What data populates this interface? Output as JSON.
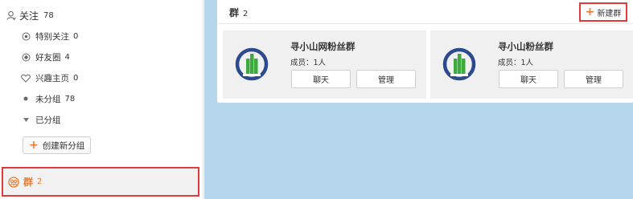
{
  "sidebar": {
    "follow": {
      "label": "关注",
      "count": "78",
      "icon": "user-icon"
    },
    "items": [
      {
        "label": "特别关注",
        "count": "0",
        "icon": "special-follow-icon"
      },
      {
        "label": "好友圈",
        "count": "4",
        "icon": "friend-circle-icon"
      },
      {
        "label": "兴趣主页",
        "count": "0",
        "icon": "heart-icon"
      },
      {
        "label": "未分组",
        "count": "78",
        "icon": "dot-icon"
      },
      {
        "label": "已分组",
        "count": "",
        "icon": "triangle-down-icon"
      }
    ],
    "create_group_label": "创建新分组",
    "group": {
      "label": "群",
      "count": "2",
      "icon": "group-icon"
    }
  },
  "main": {
    "title": "群",
    "count": "2",
    "new_group_label": "新建群",
    "groups": [
      {
        "name": "寻小山网粉丝群",
        "members": "成员：1人",
        "chat_label": "聊天",
        "manage_label": "管理"
      },
      {
        "name": "寻小山粉丝群",
        "members": "成员：1人",
        "chat_label": "聊天",
        "manage_label": "管理"
      }
    ]
  },
  "colors": {
    "accent": "#f07a2a",
    "highlight_border": "#e2393c",
    "main_background": "#b6d6ec",
    "logo_blue": "#2c4a8e",
    "logo_green": "#3daa3d"
  }
}
